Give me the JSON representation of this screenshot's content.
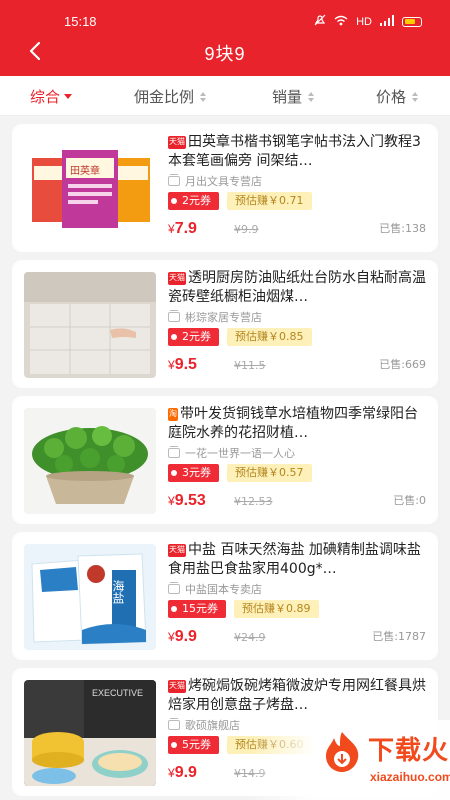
{
  "status_bar": {
    "time": "15:18",
    "network": "HD"
  },
  "header": {
    "title": "9块9"
  },
  "sort_tabs": [
    {
      "label": "综合",
      "active": true
    },
    {
      "label": "佣金比例"
    },
    {
      "label": "销量"
    },
    {
      "label": "价格"
    }
  ],
  "products": [
    {
      "badge": "天猫",
      "title": "田英章书楷书钢笔字帖书法入门教程3本套笔画偏旁 间架结…",
      "shop": "月出文具专营店",
      "coupon": "2元券",
      "earn": "预估赚￥0.71",
      "currency": "¥",
      "price": "7.9",
      "original_price": "¥9.9",
      "sold": "已售:138",
      "thumb_text": "田英章"
    },
    {
      "badge": "天猫",
      "title": "透明厨房防油贴纸灶台防水自粘耐高温瓷砖壁纸橱柜油烟煤…",
      "shop": "彬琮家居专营店",
      "coupon": "2元券",
      "earn": "预估赚￥0.85",
      "currency": "¥",
      "price": "9.5",
      "original_price": "¥11.5",
      "sold": "已售:669"
    },
    {
      "badge": "淘",
      "title": "带叶发货铜钱草水培植物四季常绿阳台庭院水养的花招财植…",
      "shop": "一花一世界一语一人心",
      "coupon": "3元券",
      "earn": "预估赚￥0.57",
      "currency": "¥",
      "price": "9.53",
      "original_price": "¥12.53",
      "sold": "已售:0"
    },
    {
      "badge": "天猫",
      "title": "中盐 百味天然海盐 加碘精制盐调味盐食用盐巴食盐家用400g*…",
      "shop": "中盐国本专卖店",
      "coupon": "15元券",
      "earn": "预估赚￥0.89",
      "currency": "¥",
      "price": "9.9",
      "original_price": "¥24.9",
      "sold": "已售:1787",
      "thumb_text": "海盐"
    },
    {
      "badge": "天猫",
      "title": "烤碗焗饭碗烤箱微波炉专用网红餐具烘焙家用创意盘子烤盘…",
      "shop": "歌硕旗舰店",
      "coupon": "5元券",
      "earn": "预估赚￥0.60",
      "currency": "¥",
      "price": "9.9",
      "original_price": "¥14.9",
      "sold": "",
      "thumb_text": "EXECUTIVE"
    }
  ],
  "watermark": {
    "text": "下载火",
    "sub": "xiazaihuo.com"
  },
  "colors": {
    "primary": "#e8232b",
    "earn_bg": "#fdf0b8",
    "earn_text": "#b5861f"
  }
}
